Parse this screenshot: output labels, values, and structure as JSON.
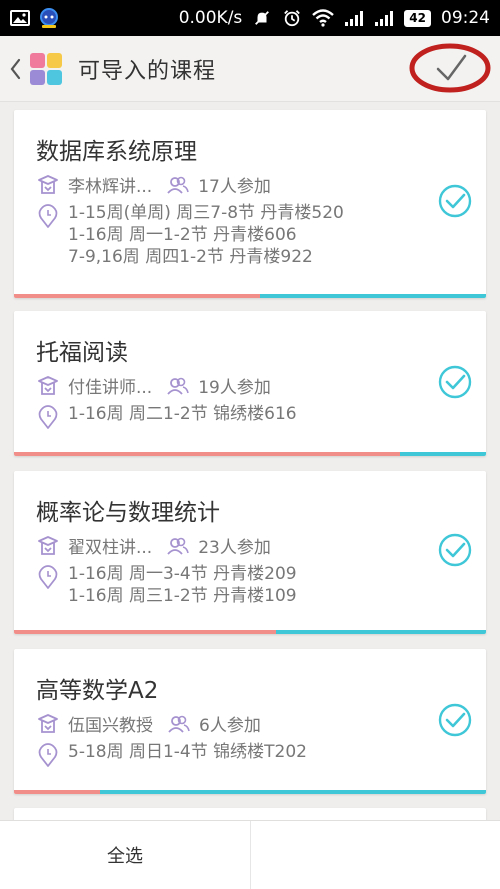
{
  "status_bar": {
    "speed": "0.00K/s",
    "battery": "42",
    "time": "09:24"
  },
  "header": {
    "title": "可导入的课程"
  },
  "courses": [
    {
      "name": "数据库系统原理",
      "teacher": "李林辉讲...",
      "participants": "17人参加",
      "schedule": [
        "1-15周(单周) 周三7-8节 丹青楼520",
        "1-16周 周一1-2节 丹青楼606",
        "7-9,16周 周四1-2节 丹青楼922"
      ],
      "selected": true
    },
    {
      "name": "托福阅读",
      "teacher": "付佳讲师...",
      "participants": "19人参加",
      "schedule": [
        "1-16周 周二1-2节 锦绣楼616"
      ],
      "selected": true
    },
    {
      "name": "概率论与数理统计",
      "teacher": "翟双柱讲...",
      "participants": "23人参加",
      "schedule": [
        "1-16周 周一3-4节 丹青楼209",
        "1-16周 周三1-2节 丹青楼109"
      ],
      "selected": true
    },
    {
      "name": "高等数学A2",
      "teacher": "伍国兴教授",
      "participants": "6人参加",
      "schedule": [
        "5-18周 周日1-4节 锦绣楼T202"
      ],
      "selected": true
    }
  ],
  "bottom": {
    "select_all": "全选",
    "right": ""
  },
  "colors": {
    "accent_teal": "#3fc7d8",
    "accent_red": "#f28e8a",
    "icon_purple": "#a592cf",
    "confirm_circle": "#c0201e"
  }
}
